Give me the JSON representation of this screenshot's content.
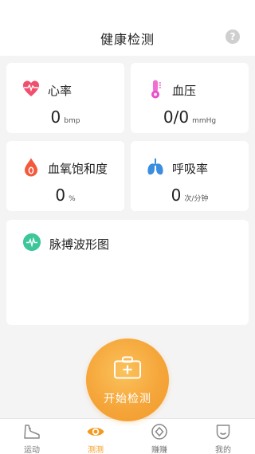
{
  "header": {
    "title": "健康检测",
    "help_glyph": "?"
  },
  "cards": {
    "heart_rate": {
      "label": "心率",
      "value": "0",
      "unit": "bmp",
      "icon": "heart-pulse-icon",
      "color": "#f0506e"
    },
    "blood_pressure": {
      "label": "血压",
      "value": "0/0",
      "unit": "mmHg",
      "icon": "thermometer-icon",
      "color": "#e84fc6"
    },
    "blood_oxygen": {
      "label": "血氧饱和度",
      "value": "0",
      "unit": "%",
      "icon": "blood-drop-icon",
      "color": "#f35a3c"
    },
    "respiration": {
      "label": "呼吸率",
      "value": "0",
      "unit": "次/分钟",
      "icon": "lungs-icon",
      "color": "#3b8de0"
    }
  },
  "waveform": {
    "label": "脉搏波形图",
    "icon": "waveform-icon",
    "color": "#3cc79a"
  },
  "start_button": {
    "label": "开始检测",
    "color": "#f5a63a"
  },
  "tabbar": {
    "active_color": "#f39a1f",
    "tabs": [
      {
        "label": "运动",
        "icon": "sneaker-icon"
      },
      {
        "label": "测测",
        "icon": "eye-icon",
        "active": true
      },
      {
        "label": "赚赚",
        "icon": "diamond-coin-icon"
      },
      {
        "label": "我的",
        "icon": "profile-icon"
      }
    ]
  }
}
